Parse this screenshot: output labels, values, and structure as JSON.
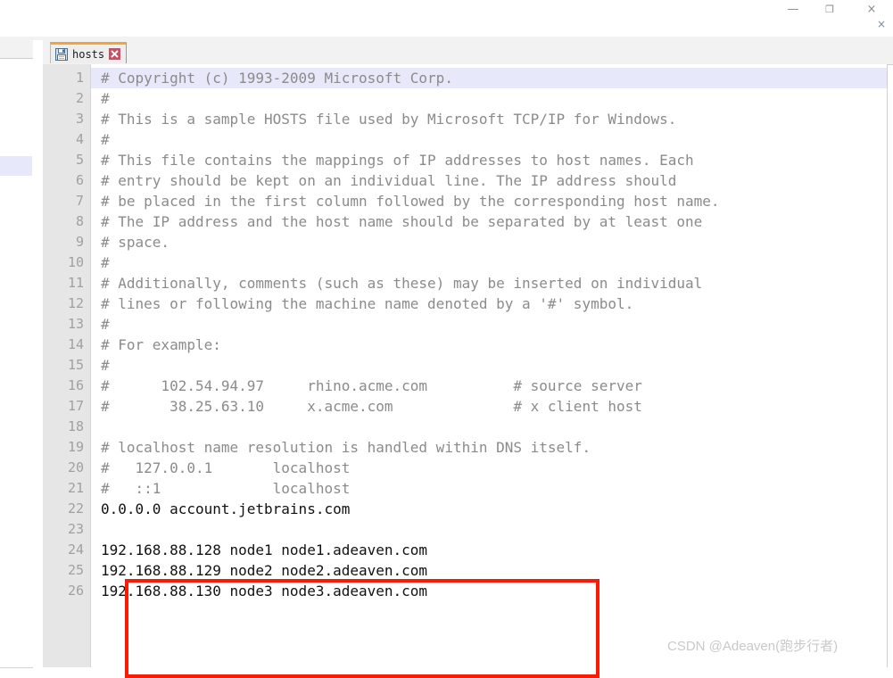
{
  "window": {
    "controls": [
      {
        "name": "minimize",
        "glyph": "—"
      },
      {
        "name": "maximize",
        "glyph": "❐"
      },
      {
        "name": "close",
        "glyph": "×"
      }
    ],
    "secondary_close_glyph": "×"
  },
  "left_panel": {
    "collapse_arrow_glyph": "◀"
  },
  "tab": {
    "label": "hosts",
    "save_icon": "floppy-disk-icon",
    "close_icon": "close-icon",
    "accent_color": "#f2a33c"
  },
  "editor": {
    "current_line": 1,
    "comment_color": "#8b8b8b",
    "entry_color": "#111111",
    "current_line_bg": "#e8e8fb",
    "lines": [
      {
        "n": 1,
        "text": "# Copyright (c) 1993-2009 Microsoft Corp.",
        "kind": "comment"
      },
      {
        "n": 2,
        "text": "#",
        "kind": "comment"
      },
      {
        "n": 3,
        "text": "# This is a sample HOSTS file used by Microsoft TCP/IP for Windows.",
        "kind": "comment"
      },
      {
        "n": 4,
        "text": "#",
        "kind": "comment"
      },
      {
        "n": 5,
        "text": "# This file contains the mappings of IP addresses to host names. Each",
        "kind": "comment"
      },
      {
        "n": 6,
        "text": "# entry should be kept on an individual line. The IP address should",
        "kind": "comment"
      },
      {
        "n": 7,
        "text": "# be placed in the first column followed by the corresponding host name.",
        "kind": "comment"
      },
      {
        "n": 8,
        "text": "# The IP address and the host name should be separated by at least one",
        "kind": "comment"
      },
      {
        "n": 9,
        "text": "# space.",
        "kind": "comment"
      },
      {
        "n": 10,
        "text": "#",
        "kind": "comment"
      },
      {
        "n": 11,
        "text": "# Additionally, comments (such as these) may be inserted on individual",
        "kind": "comment"
      },
      {
        "n": 12,
        "text": "# lines or following the machine name denoted by a '#' symbol.",
        "kind": "comment"
      },
      {
        "n": 13,
        "text": "#",
        "kind": "comment"
      },
      {
        "n": 14,
        "text": "# For example:",
        "kind": "comment"
      },
      {
        "n": 15,
        "text": "#",
        "kind": "comment"
      },
      {
        "n": 16,
        "text": "#      102.54.94.97     rhino.acme.com          # source server",
        "kind": "comment"
      },
      {
        "n": 17,
        "text": "#       38.25.63.10     x.acme.com              # x client host",
        "kind": "comment"
      },
      {
        "n": 18,
        "text": "",
        "kind": "comment"
      },
      {
        "n": 19,
        "text": "# localhost name resolution is handled within DNS itself.",
        "kind": "comment"
      },
      {
        "n": 20,
        "text": "#   127.0.0.1       localhost",
        "kind": "comment"
      },
      {
        "n": 21,
        "text": "#   ::1             localhost",
        "kind": "comment"
      },
      {
        "n": 22,
        "text": "0.0.0.0 account.jetbrains.com",
        "kind": "entry"
      },
      {
        "n": 23,
        "text": "",
        "kind": "entry"
      },
      {
        "n": 24,
        "text": "192.168.88.128 node1 node1.adeaven.com",
        "kind": "entry"
      },
      {
        "n": 25,
        "text": "192.168.88.129 node2 node2.adeaven.com",
        "kind": "entry"
      },
      {
        "n": 26,
        "text": "192.168.88.130 node3 node3.adeaven.com",
        "kind": "entry"
      }
    ]
  },
  "annotation": {
    "color": "#fc1905",
    "highlighted_lines": [
      24,
      25,
      26
    ]
  },
  "watermark": {
    "text": "CSDN @Adeaven(跑步行者)"
  }
}
